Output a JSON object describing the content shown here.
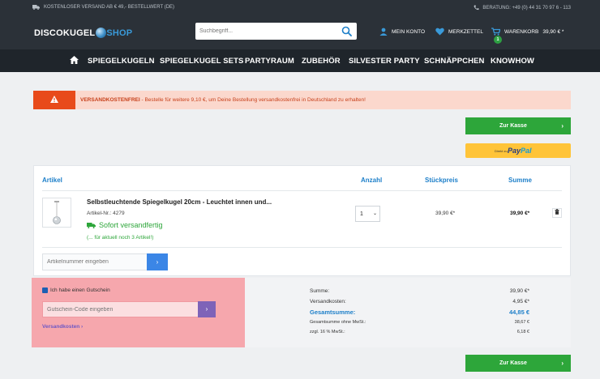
{
  "topbar": {
    "shipping_note": "KOSTENLOSER VERSAND AB € 49,- BESTELLWERT (DE)",
    "hotline": "BERATUNG: +49 (0) 44 31 70 97 6 - 113"
  },
  "header": {
    "logo_main": "DISCOKUGEL",
    "logo_accent": "SHOP",
    "search_placeholder": "Suchbegriff...",
    "account_label": "MEIN KONTO",
    "wishlist_label": "MERKZETTEL",
    "cart_label": "WARENKORB",
    "cart_amount": "39,90 € *",
    "cart_count": "1"
  },
  "nav": {
    "items": [
      "SPIEGELKUGELN",
      "SPIEGELKUGEL SETS",
      "PARTYRAUM",
      "ZUBEHÖR",
      "SILVESTER PARTY",
      "SCHNÄPPCHEN",
      "KNOWHOW"
    ]
  },
  "alert": {
    "strong": "VERSANDKOSTENFREI",
    "text": " - Bestelle für weitere 9,10 €, um Deine Bestellung versandkostenfrei in Deutschland zu erhalten!"
  },
  "checkout": {
    "label": "Zur Kasse",
    "paypal_small": "Direkt zu",
    "paypal_pay": "Pay",
    "paypal_pal": "Pal"
  },
  "cart": {
    "headers": {
      "article": "Artikel",
      "quantity": "Anzahl",
      "unit_price": "Stückpreis",
      "sum": "Summe"
    },
    "item": {
      "title": "Selbstleuchtende Spiegelkugel 20cm - Leuchtet innen und...",
      "number": "Artikel-Nr.: 4279",
      "shipping": "Sofort versandfertig",
      "stock": "(... für aktuell noch 3 Artikel!)",
      "quantity": "1",
      "unit_price": "39,90 €*",
      "total": "39,90 €*"
    },
    "article_input_placeholder": "Artikelnummer eingeben"
  },
  "voucher": {
    "checkbox_label": "Ich habe einen Gutschein",
    "input_placeholder": "Gutschein-Code eingeben",
    "shipping_link": "Versandkosten"
  },
  "summary": {
    "sum_label": "Summe:",
    "sum_value": "39,90 €*",
    "shipping_label": "Versandkosten:",
    "shipping_value": "4,95 €*",
    "grand_label": "Gesamtsumme:",
    "grand_value": "44,85 €",
    "net_label": "Gesamtsumme ohne MwSt.:",
    "net_value": "38,67 €",
    "vat_label": "zzgl. 16 % MwSt.:",
    "vat_value": "6,18 €"
  },
  "colors": {
    "header_bg": "#2b3138",
    "nav_bg": "#1f252b",
    "accent_blue": "#1d7fc9",
    "green": "#2da63a",
    "alert_orange": "#e84a1a",
    "paypal_yellow": "#ffc439"
  }
}
